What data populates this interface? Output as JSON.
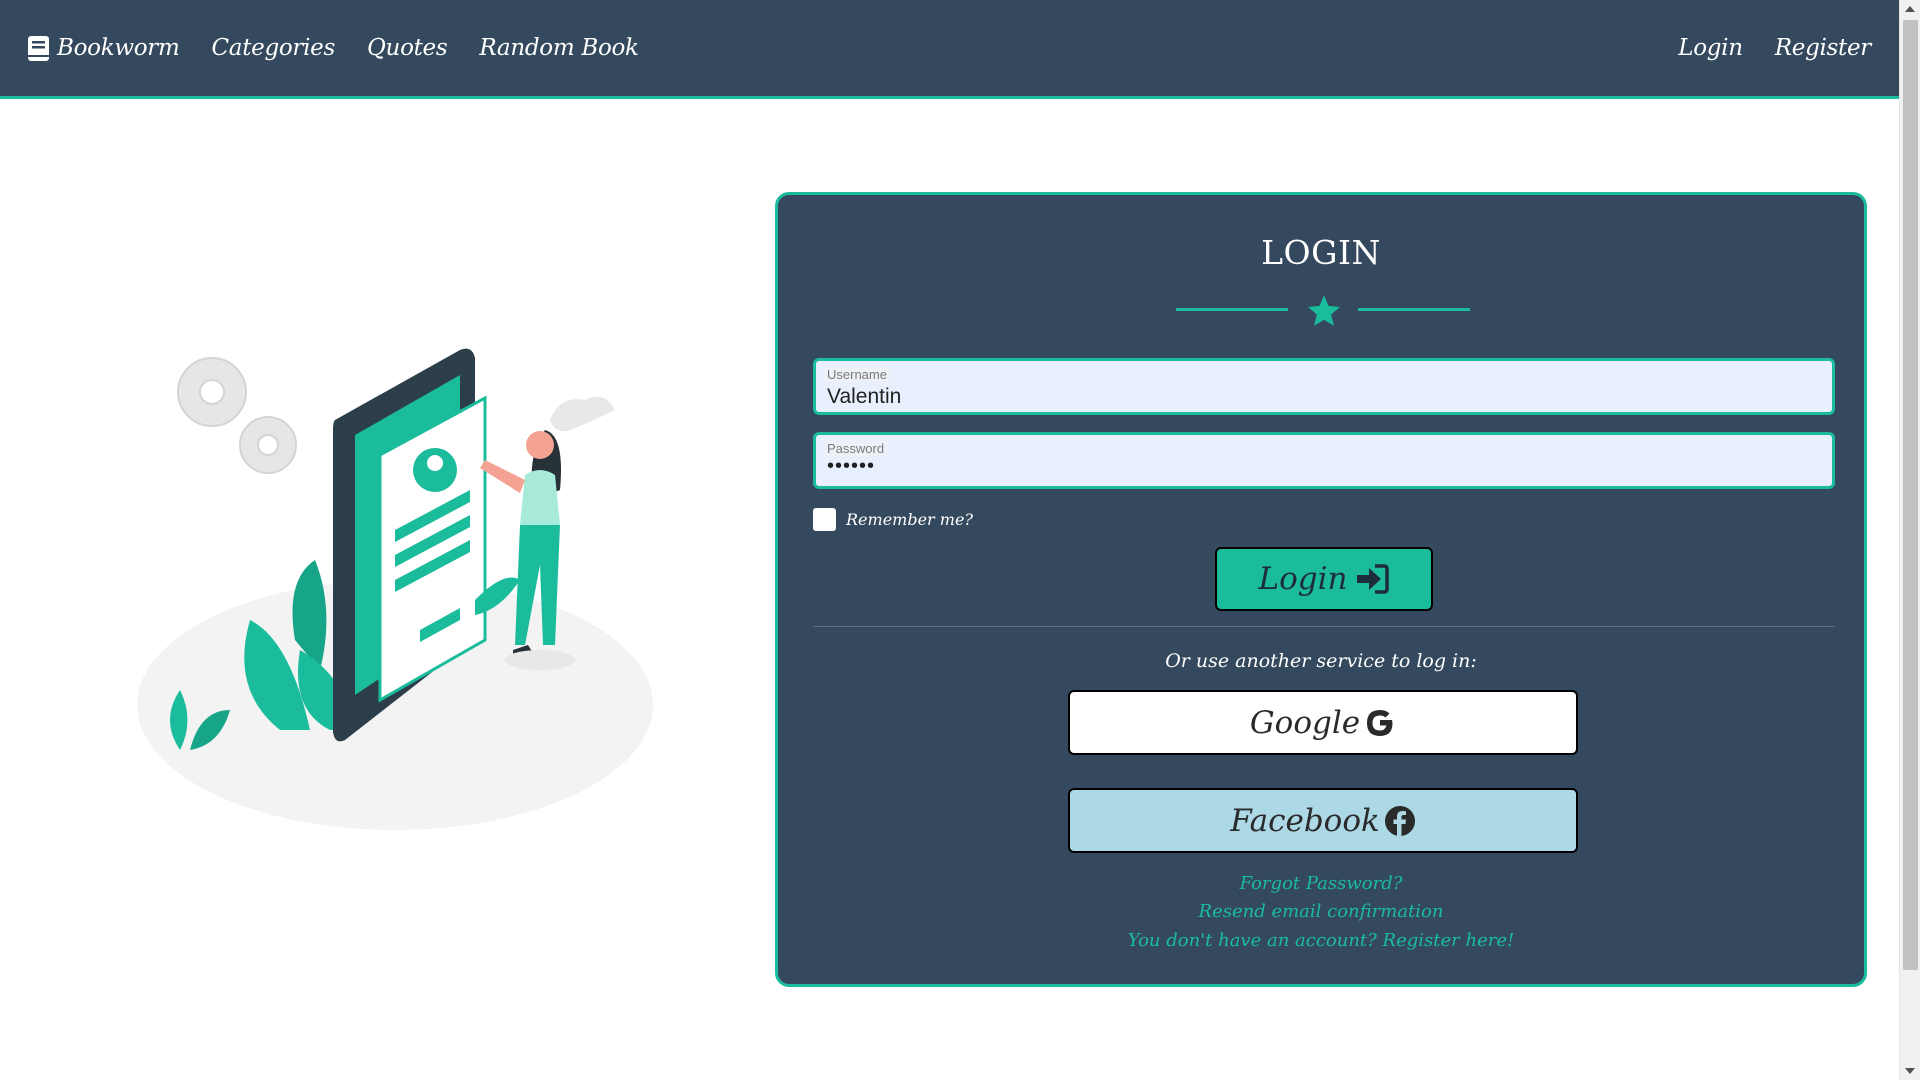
{
  "nav": {
    "brand": "Bookworm",
    "links": [
      "Categories",
      "Quotes",
      "Random Book"
    ],
    "login": "Login",
    "register": "Register"
  },
  "login_form": {
    "title": "LOGIN",
    "username_label": "Username",
    "username_value": "Valentin",
    "password_label": "Password",
    "password_value": "••••••",
    "remember_label": "Remember me?",
    "submit_label": "Login",
    "alt_text": "Or use another service to log in:",
    "google_label": "Google",
    "facebook_label": "Facebook",
    "forgot_password": "Forgot Password?",
    "resend_email": "Resend email confirmation",
    "register_prompt": "You don't have an account? Register here!"
  },
  "colors": {
    "navbar": "#34495e",
    "accent": "#1abc9c",
    "card": "#34495e",
    "facebook_button": "#add8e6"
  },
  "icons": {
    "brand": "book-icon",
    "divider": "star-icon",
    "submit": "sign-in-icon",
    "google": "google-icon",
    "facebook": "facebook-icon"
  }
}
